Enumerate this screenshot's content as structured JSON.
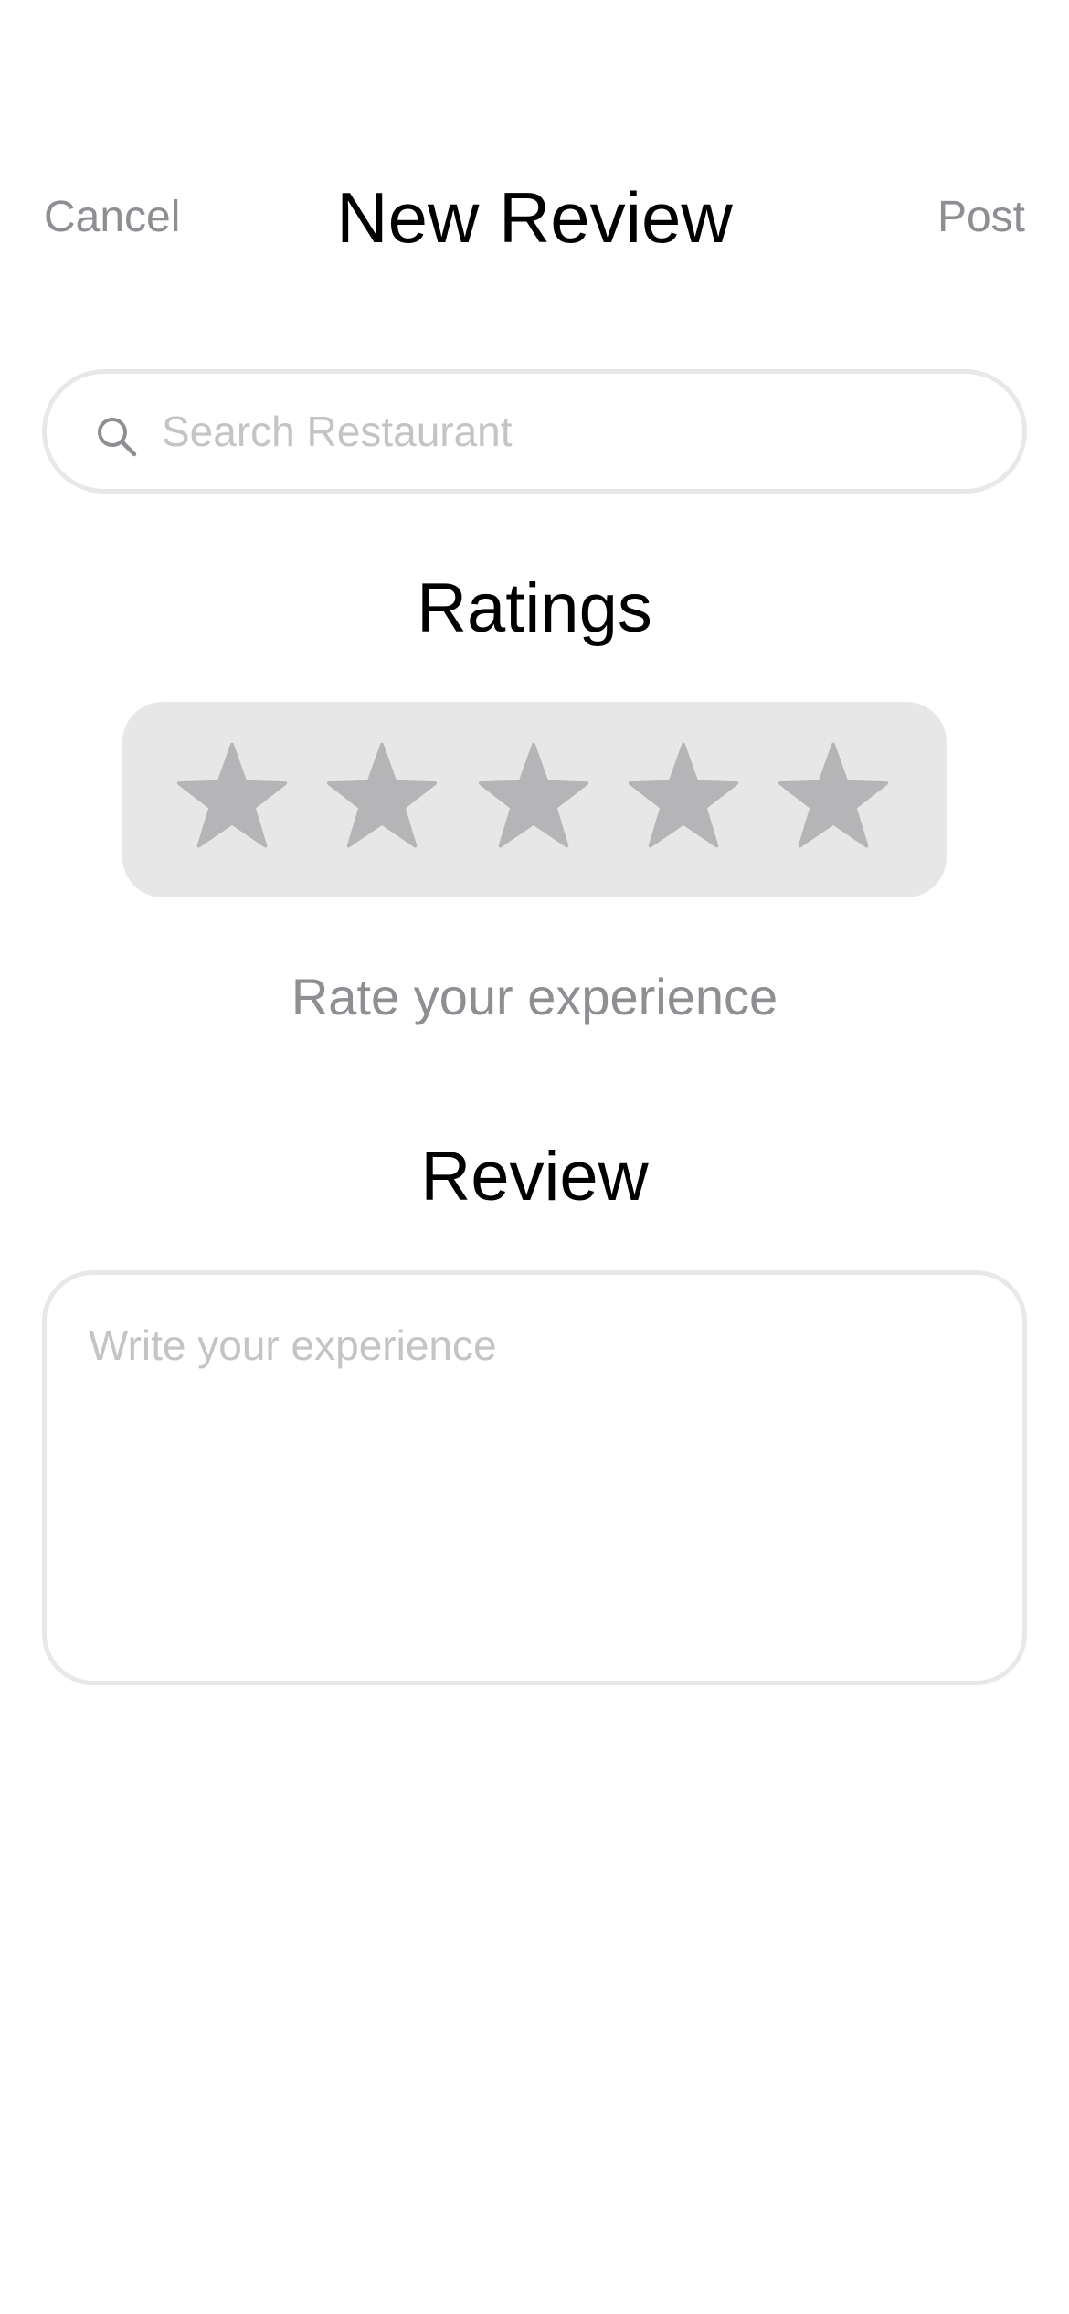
{
  "nav": {
    "cancel_label": "Cancel",
    "title": "New Review",
    "post_label": "Post"
  },
  "search": {
    "placeholder": "Search Restaurant",
    "value": "",
    "icon": "search-icon"
  },
  "ratings": {
    "title": "Ratings",
    "max_stars": 5,
    "selected": 0,
    "star_icon": "star-icon",
    "caption": "Rate your experience"
  },
  "review": {
    "title": "Review",
    "placeholder": "Write your experience",
    "value": ""
  },
  "colors": {
    "star_inactive": "#b5b5b7",
    "star_panel": "#e7e7e7",
    "secondary_text": "#8e8e93",
    "placeholder": "#c4c4c6",
    "border": "#e8e8e8"
  }
}
